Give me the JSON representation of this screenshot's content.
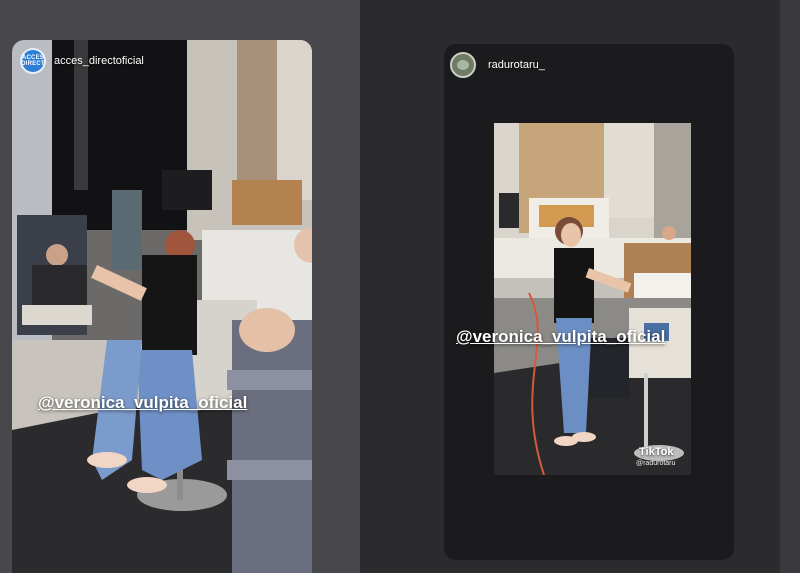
{
  "stories": [
    {
      "username": "acces_directoficial",
      "avatar_text": "ACCES DIRECT",
      "mention": "@veronica_vulpita_oficial"
    },
    {
      "username": "radurotaru_",
      "mention": "@veronica_vulpita_oficial",
      "watermark": {
        "brand": "TikTok",
        "handle": "@radurotaru"
      }
    }
  ],
  "colors": {
    "background": "#48474b",
    "story_dark": "#1b1b1d",
    "acces_brand": "#2d7fd6"
  }
}
